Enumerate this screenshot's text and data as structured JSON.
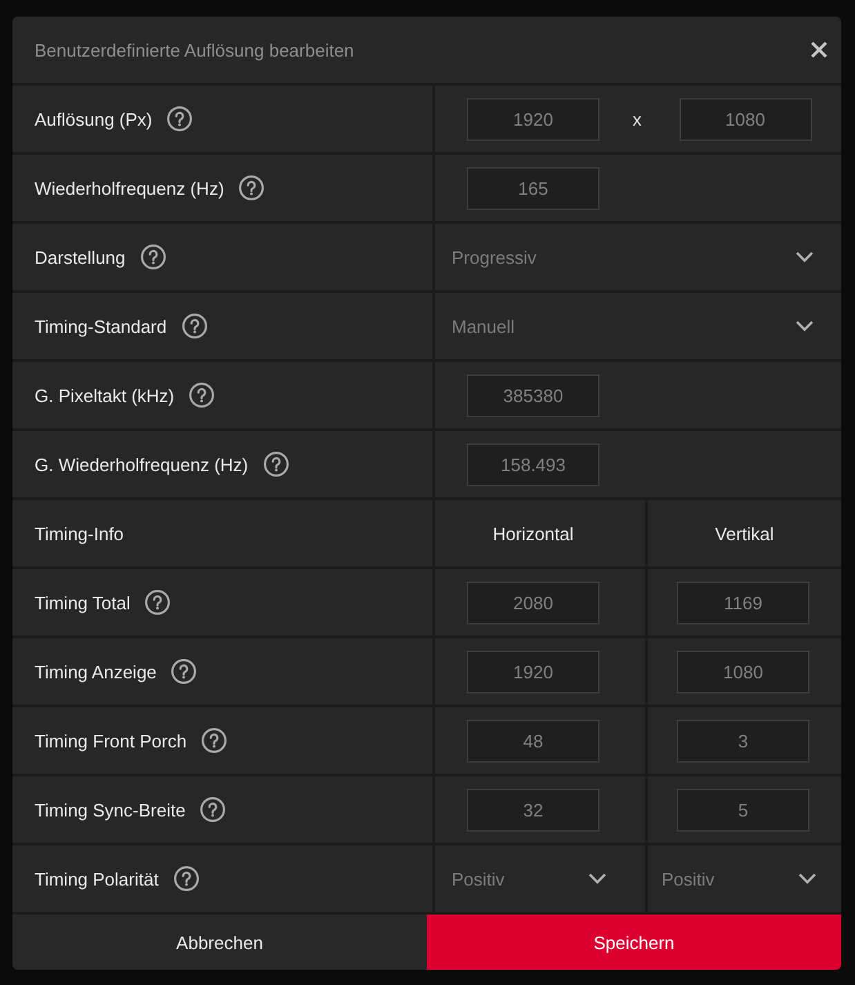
{
  "dialog": {
    "title": "Benutzerdefinierte Auflösung bearbeiten"
  },
  "rows": [
    {
      "kind": "pair",
      "label": "Auflösung (Px)",
      "help": true,
      "values": [
        "1920",
        "1080"
      ],
      "joiner": "x"
    },
    {
      "kind": "input",
      "label": "Wiederholfrequenz (Hz)",
      "help": true,
      "value": "165"
    },
    {
      "kind": "dropdown",
      "label": "Darstellung",
      "help": true,
      "value": "Progressiv"
    },
    {
      "kind": "dropdown",
      "label": "Timing-Standard",
      "help": true,
      "value": "Manuell"
    },
    {
      "kind": "input",
      "label": "G. Pixeltakt (kHz)",
      "help": true,
      "value": "385380"
    },
    {
      "kind": "input",
      "label": "G. Wiederholfrequenz (Hz)",
      "help": true,
      "value": "158.493"
    },
    {
      "kind": "header",
      "label": "Timing-Info",
      "help": false,
      "columns": [
        "Horizontal",
        "Vertikal"
      ]
    },
    {
      "kind": "timing",
      "label": "Timing Total",
      "help": true,
      "values": [
        "2080",
        "1169"
      ]
    },
    {
      "kind": "timing",
      "label": "Timing Anzeige",
      "help": true,
      "values": [
        "1920",
        "1080"
      ]
    },
    {
      "kind": "timing",
      "label": "Timing Front Porch",
      "help": true,
      "values": [
        "48",
        "3"
      ]
    },
    {
      "kind": "timing",
      "label": "Timing Sync-Breite",
      "help": true,
      "values": [
        "32",
        "5"
      ]
    },
    {
      "kind": "timing_dropdown",
      "label": "Timing Polarität",
      "help": true,
      "values": [
        "Positiv",
        "Positiv"
      ]
    }
  ],
  "buttons": [
    {
      "label": "Abbrechen",
      "kind": "secondary"
    },
    {
      "label": "Speichern",
      "kind": "primary"
    }
  ]
}
